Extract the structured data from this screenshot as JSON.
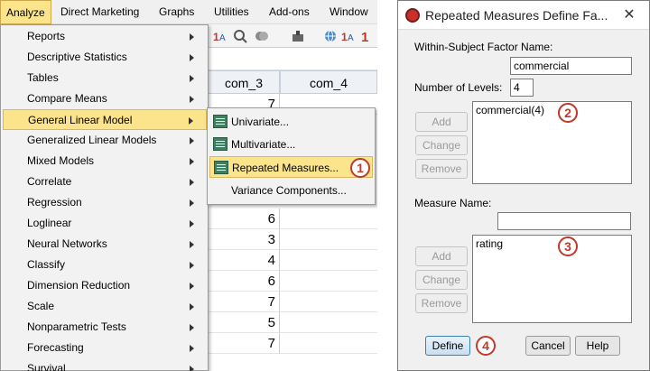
{
  "menubar": {
    "items": [
      {
        "label": "Analyze"
      },
      {
        "label": "Direct Marketing"
      },
      {
        "label": "Graphs"
      },
      {
        "label": "Utilities"
      },
      {
        "label": "Add-ons"
      },
      {
        "label": "Window"
      }
    ]
  },
  "analyze_menu": {
    "items": [
      {
        "label": "Reports"
      },
      {
        "label": "Descriptive Statistics"
      },
      {
        "label": "Tables"
      },
      {
        "label": "Compare Means"
      },
      {
        "label": "General Linear Model"
      },
      {
        "label": "Generalized Linear Models"
      },
      {
        "label": "Mixed Models"
      },
      {
        "label": "Correlate"
      },
      {
        "label": "Regression"
      },
      {
        "label": "Loglinear"
      },
      {
        "label": "Neural Networks"
      },
      {
        "label": "Classify"
      },
      {
        "label": "Dimension Reduction"
      },
      {
        "label": "Scale"
      },
      {
        "label": "Nonparametric Tests"
      },
      {
        "label": "Forecasting"
      },
      {
        "label": "Survival"
      }
    ]
  },
  "glm_submenu": {
    "items": [
      {
        "label": "Univariate..."
      },
      {
        "label": "Multivariate..."
      },
      {
        "label": "Repeated Measures..."
      },
      {
        "label": "Variance Components..."
      }
    ]
  },
  "grid": {
    "columns": [
      "com_3",
      "com_4"
    ],
    "col1_values": [
      "7",
      "6",
      "3",
      "4",
      "6",
      "7",
      "5",
      "7"
    ]
  },
  "dialog": {
    "title": "Repeated Measures Define Fa...",
    "close_label": "✕",
    "factor_name_label": "Within-Subject Factor Name:",
    "factor_name_value": "commercial",
    "levels_label": "Number of Levels:",
    "levels_value": "4",
    "factor_list": [
      "commercial(4)"
    ],
    "add_label": "Add",
    "change_label": "Change",
    "remove_label": "Remove",
    "measure_name_label": "Measure Name:",
    "measure_name_value": "",
    "measure_list": [
      "rating"
    ],
    "define_label": "Define",
    "cancel_label": "Cancel",
    "help_label": "Help"
  },
  "badges": [
    "1",
    "2",
    "3",
    "4"
  ],
  "colors": {
    "highlight": "#fbe48c",
    "badge_red": "#c0392b",
    "primary_border": "#3c7fb1"
  }
}
